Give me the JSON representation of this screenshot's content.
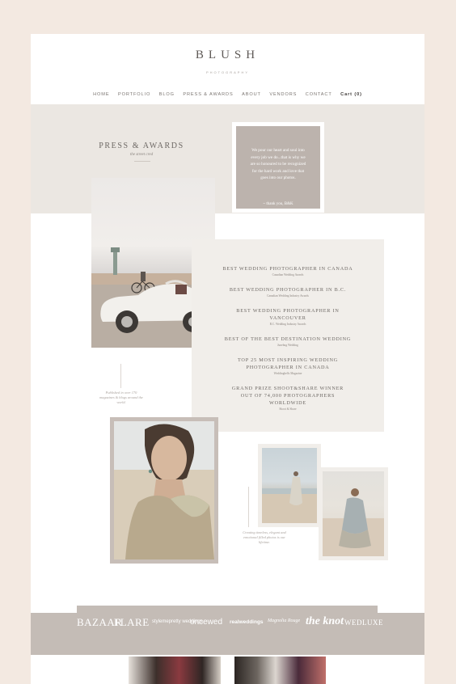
{
  "brand": {
    "name": "BLUSH",
    "tagline": "PHOTOGRAPHY"
  },
  "nav": {
    "items": [
      "HOME",
      "PORTFOLIO",
      "BLOG",
      "PRESS & AWARDS",
      "ABOUT",
      "VENDORS",
      "CONTACT"
    ],
    "cart": "Cart (0)"
  },
  "hero": {
    "title": "PRESS & AWARDS",
    "subtitle": "the street cred"
  },
  "quote": {
    "text": "We pour our heart and soul into every job we do...that is why we are so honoured to be recognized for the hard work and love that goes into our photos.",
    "sign": "~ thank you, B&K"
  },
  "awards": [
    {
      "title": "BEST WEDDING PHOTOGRAPHER IN CANADA",
      "org": "Canadian Wedding Awards"
    },
    {
      "title": "BEST WEDDING PHOTOGRAPHER IN B.C.",
      "org": "Canadian Wedding Industry Awards"
    },
    {
      "title": "BEST WEDDING PHOTOGRAPHER IN VANCOUVER",
      "org": "B.C. Wedding Industry Awards"
    },
    {
      "title": "BEST OF THE BEST DESTINATION WEDDING",
      "org": "Junebug Wedding"
    },
    {
      "title": "TOP 25 MOST INSPIRING WEDDING PHOTOGRAPHER IN CANADA",
      "org": "Weddingbells Magazine"
    },
    {
      "title": "GRAND PRIZE SHOOT&SHARE WINNER OUT OF 74,000 PHOTOGRAPHERS WORLDWIDE",
      "org": "Shoot & Share"
    }
  ],
  "captions": {
    "published": "Published in over 170 magazines & blogs around the world.",
    "creating": "Creating timeless, elegant and emotional filled photos is our lifetime."
  },
  "press_logos": [
    "BAZAAR",
    "FLARE",
    "stylemepretty weddings",
    "oncewed",
    "realweddings",
    "Magnolia Rouge",
    "the knot",
    "WEDLUXE"
  ],
  "colors": {
    "background": "#f3e9e1",
    "band": "#ebe7e2",
    "quote_box": "#bcb3ad",
    "strip": "#c4bcb6"
  }
}
